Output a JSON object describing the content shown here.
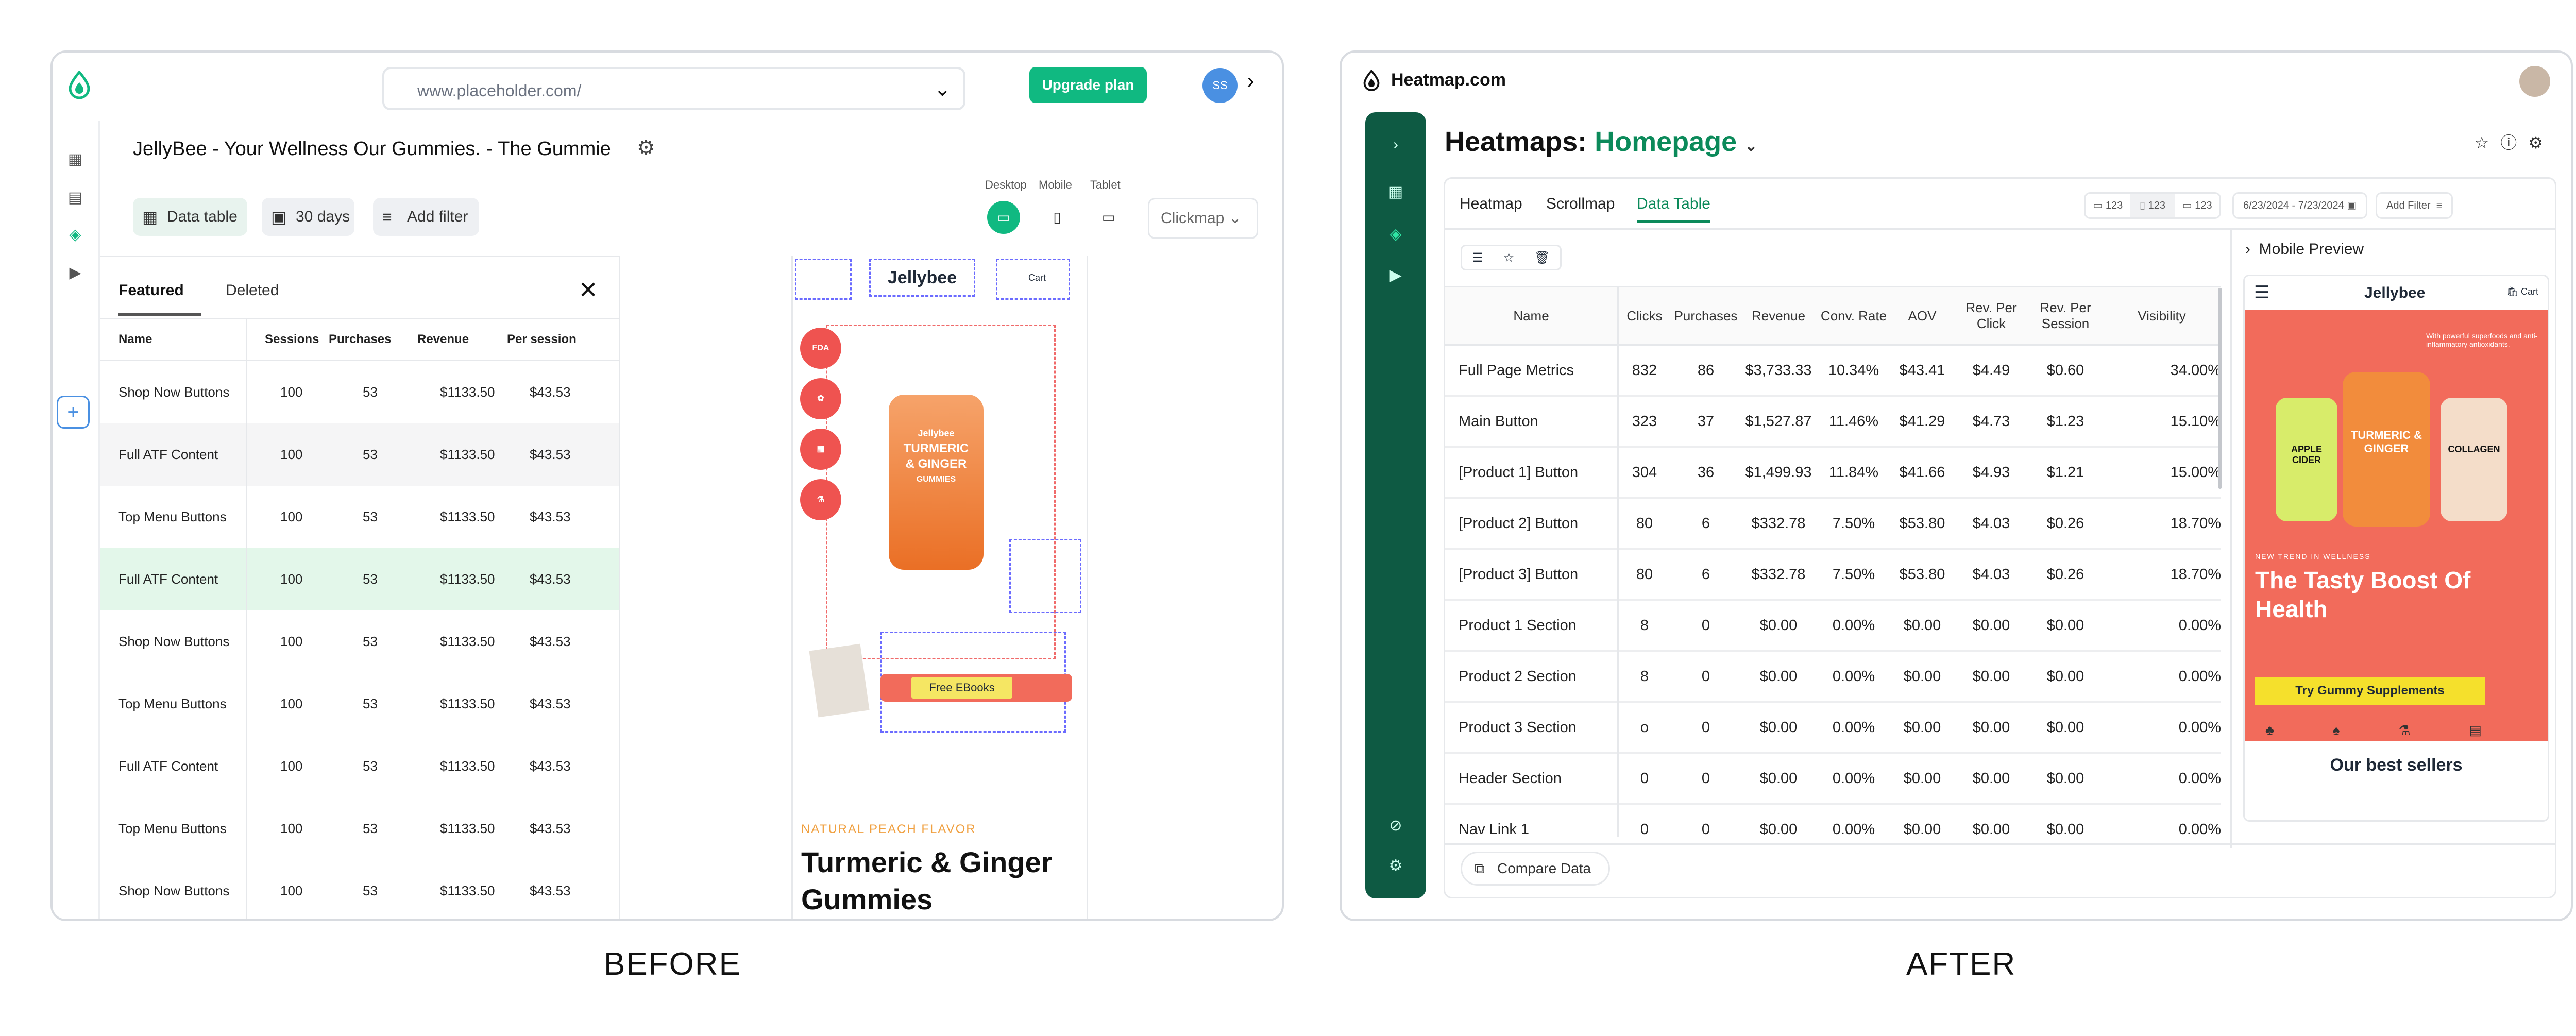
{
  "captions": {
    "before": "BEFORE",
    "after": "AFTER"
  },
  "before": {
    "url": "www.placeholder.com/",
    "upgrade_label": "Upgrade plan",
    "avatar_initials": "SS",
    "page_title": "JellyBee - Your Wellness Our Gummies. - The Gummie",
    "toolbar": {
      "data_table": "Data table",
      "date_range": "30 days",
      "add_filter": "Add filter"
    },
    "devices": {
      "desktop": "Desktop",
      "mobile": "Mobile",
      "tablet": "Tablet"
    },
    "map_select": "Clickmap",
    "tabs": {
      "featured": "Featured",
      "deleted": "Deleted"
    },
    "columns": [
      "Name",
      "Sessions",
      "Purchases",
      "Revenue",
      "Per session"
    ],
    "rows": [
      {
        "name": "Shop Now Buttons",
        "sessions": "100",
        "purchases": "53",
        "revenue": "$1133.50",
        "per": "$43.53"
      },
      {
        "name": "Full ATF Content",
        "sessions": "100",
        "purchases": "53",
        "revenue": "$1133.50",
        "per": "$43.53"
      },
      {
        "name": "Top Menu Buttons",
        "sessions": "100",
        "purchases": "53",
        "revenue": "$1133.50",
        "per": "$43.53"
      },
      {
        "name": "Full ATF Content",
        "sessions": "100",
        "purchases": "53",
        "revenue": "$1133.50",
        "per": "$43.53"
      },
      {
        "name": "Shop Now Buttons",
        "sessions": "100",
        "purchases": "53",
        "revenue": "$1133.50",
        "per": "$43.53"
      },
      {
        "name": "Top Menu Buttons",
        "sessions": "100",
        "purchases": "53",
        "revenue": "$1133.50",
        "per": "$43.53"
      },
      {
        "name": "Full ATF Content",
        "sessions": "100",
        "purchases": "53",
        "revenue": "$1133.50",
        "per": "$43.53"
      },
      {
        "name": "Top Menu Buttons",
        "sessions": "100",
        "purchases": "53",
        "revenue": "$1133.50",
        "per": "$43.53"
      },
      {
        "name": "Shop Now Buttons",
        "sessions": "100",
        "purchases": "53",
        "revenue": "$1133.50",
        "per": "$43.53"
      }
    ],
    "preview": {
      "brand": "Jellybee",
      "cart": "Cart",
      "badge1": "FDA",
      "bottle_brand": "Jellybee",
      "bottle_title": "TURMERIC & GINGER",
      "bottle_sub": "GUMMIES",
      "cta": "Free EBooks",
      "flavor": "NATURAL PEACH FLAVOR",
      "product_title": "Turmeric & Ginger Gummies"
    }
  },
  "after": {
    "brand": "Heatmap.com",
    "heading_prefix": "Heatmaps:",
    "heading_page": "Homepage",
    "tabs": {
      "heatmap": "Heatmap",
      "scrollmap": "Scrollmap",
      "data_table": "Data Table"
    },
    "device_counts": {
      "desktop": "123",
      "mobile": "123",
      "tablet": "123"
    },
    "date_range": "6/23/2024 - 7/23/2024",
    "add_filter": "Add Filter",
    "columns": [
      "Name",
      "Clicks",
      "Purchases",
      "Revenue",
      "Conv. Rate",
      "AOV",
      "Rev. Per Click",
      "Rev. Per Session",
      "Visibility"
    ],
    "rows": [
      [
        "Full Page Metrics",
        "832",
        "86",
        "$3,733.33",
        "10.34%",
        "$43.41",
        "$4.49",
        "$0.60",
        "34.00%"
      ],
      [
        "Main Button",
        "323",
        "37",
        "$1,527.87",
        "11.46%",
        "$41.29",
        "$4.73",
        "$1.23",
        "15.10%"
      ],
      [
        "[Product 1] Button",
        "304",
        "36",
        "$1,499.93",
        "11.84%",
        "$41.66",
        "$4.93",
        "$1.21",
        "15.00%"
      ],
      [
        "[Product 2] Button",
        "80",
        "6",
        "$332.78",
        "7.50%",
        "$53.80",
        "$4.03",
        "$0.26",
        "18.70%"
      ],
      [
        "[Product 3] Button",
        "80",
        "6",
        "$332.78",
        "7.50%",
        "$53.80",
        "$4.03",
        "$0.26",
        "18.70%"
      ],
      [
        "Product 1 Section",
        "8",
        "0",
        "$0.00",
        "0.00%",
        "$0.00",
        "$0.00",
        "$0.00",
        "0.00%"
      ],
      [
        "Product 2 Section",
        "8",
        "0",
        "$0.00",
        "0.00%",
        "$0.00",
        "$0.00",
        "$0.00",
        "0.00%"
      ],
      [
        "Product 3 Section",
        "o",
        "0",
        "$0.00",
        "0.00%",
        "$0.00",
        "$0.00",
        "$0.00",
        "0.00%"
      ],
      [
        "Header Section",
        "0",
        "0",
        "$0.00",
        "0.00%",
        "$0.00",
        "$0.00",
        "$0.00",
        "0.00%"
      ],
      [
        "Nav Link 1",
        "0",
        "0",
        "$0.00",
        "0.00%",
        "$0.00",
        "$0.00",
        "$0.00",
        "0.00%"
      ]
    ],
    "mobile_preview": {
      "label": "Mobile Preview",
      "brand": "Jellybee",
      "cart": "Cart",
      "hero_note": "With powerful superfoods and anti-inflammatory antioxidants.",
      "kicker": "NEW TREND IN WELLNESS",
      "title": "The Tasty Boost Of Health",
      "cta": "Try Gummy Supplements",
      "sellers": "Our best sellers",
      "bottle1": "APPLE CIDER",
      "bottle2": "TURMERIC & GINGER",
      "bottle3": "COLLAGEN"
    },
    "compare_label": "Compare Data"
  },
  "colors": {
    "accent": "#10b981",
    "sidebar": "#0e5a43",
    "heading_accent": "#0b8a5a",
    "promo": "#f26b5b"
  }
}
